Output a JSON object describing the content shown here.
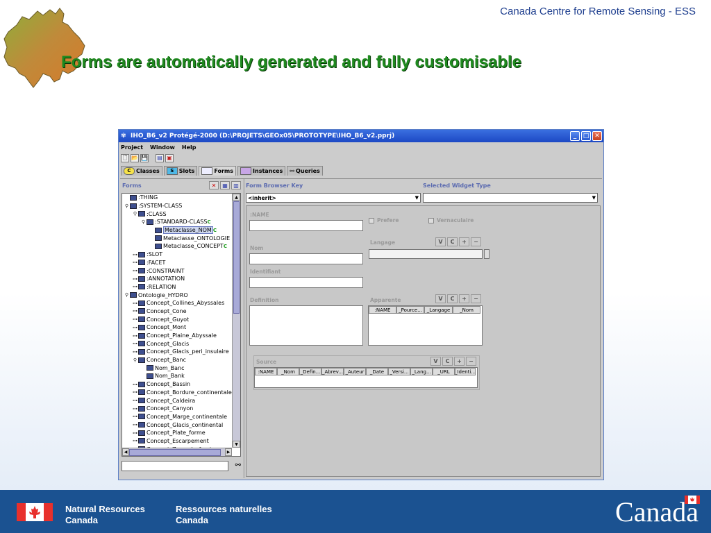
{
  "slide": {
    "header_text": "Canada Centre for Remote Sensing - ESS",
    "title": "Forms are automatically generated and fully customisable"
  },
  "window": {
    "title": "IHO_B6_v2 Protégé-2000    (D:\\PROJETS\\GEOx05\\PROTOTYPE\\IHO_B6_v2.pprj)",
    "controls": [
      "_",
      "□",
      "✕"
    ]
  },
  "menu": [
    "Project",
    "Window",
    "Help"
  ],
  "tabs": [
    {
      "icon": "C",
      "label": "Classes"
    },
    {
      "icon": "S",
      "label": "Slots"
    },
    {
      "icon": "",
      "label": "Forms"
    },
    {
      "icon": "",
      "label": "Instances"
    },
    {
      "icon": "",
      "label": "Queries"
    }
  ],
  "left_panel": {
    "header": "Forms",
    "tree": [
      {
        "indent": 0,
        "toggle": "",
        "label": ":THING"
      },
      {
        "indent": 0,
        "toggle": "⚲",
        "label": ":SYSTEM-CLASS"
      },
      {
        "indent": 1,
        "toggle": "⚲",
        "label": ":CLASS"
      },
      {
        "indent": 2,
        "toggle": "⚲",
        "label": ":STANDARD-CLASS",
        "sup": "C"
      },
      {
        "indent": 3,
        "toggle": "",
        "label": "Metaclasse_NOM",
        "sup": "C",
        "selected": true
      },
      {
        "indent": 3,
        "toggle": "",
        "label": "Metaclasse_ONTOLOGIE"
      },
      {
        "indent": 3,
        "toggle": "",
        "label": "Metaclasse_CONCEPT",
        "sup": "C"
      },
      {
        "indent": 1,
        "toggle": "⊶",
        "label": ":SLOT"
      },
      {
        "indent": 1,
        "toggle": "⊶",
        "label": ":FACET"
      },
      {
        "indent": 1,
        "toggle": "⊶",
        "label": ":CONSTRAINT"
      },
      {
        "indent": 1,
        "toggle": "⊶",
        "label": ":ANNOTATION"
      },
      {
        "indent": 1,
        "toggle": "⊶",
        "label": ":RELATION"
      },
      {
        "indent": 0,
        "toggle": "⚲",
        "label": "Ontologie_HYDRO"
      },
      {
        "indent": 1,
        "toggle": "⊶",
        "label": "Concept_Collines_Abyssales"
      },
      {
        "indent": 1,
        "toggle": "⊶",
        "label": "Concept_Cone"
      },
      {
        "indent": 1,
        "toggle": "⊶",
        "label": "Concept_Guyot"
      },
      {
        "indent": 1,
        "toggle": "⊶",
        "label": "Concept_Mont"
      },
      {
        "indent": 1,
        "toggle": "⊶",
        "label": "Concept_Plaine_Abyssale"
      },
      {
        "indent": 1,
        "toggle": "⊶",
        "label": "Concept_Glacis"
      },
      {
        "indent": 1,
        "toggle": "⊶",
        "label": "Concept_Glacis_peri_insulaire"
      },
      {
        "indent": 1,
        "toggle": "⚲",
        "label": "Concept_Banc"
      },
      {
        "indent": 2,
        "toggle": "",
        "label": "Nom_Banc"
      },
      {
        "indent": 2,
        "toggle": "",
        "label": "Nom_Bank"
      },
      {
        "indent": 1,
        "toggle": "⊶",
        "label": "Concept_Bassin"
      },
      {
        "indent": 1,
        "toggle": "⊶",
        "label": "Concept_Bordure_continentale"
      },
      {
        "indent": 1,
        "toggle": "⊶",
        "label": "Concept_Caldeira"
      },
      {
        "indent": 1,
        "toggle": "⊶",
        "label": "Concept_Canyon"
      },
      {
        "indent": 1,
        "toggle": "⊶",
        "label": "Concept_Marge_continentale"
      },
      {
        "indent": 1,
        "toggle": "⊶",
        "label": "Concept_Glacis_continental"
      },
      {
        "indent": 1,
        "toggle": "⊶",
        "label": "Concept_Plate_forme"
      },
      {
        "indent": 1,
        "toggle": "⊶",
        "label": "Concept_Escarpement"
      },
      {
        "indent": 1,
        "toggle": "⊶",
        "label": "Concept_Zone_de_fractures"
      }
    ],
    "find_value": ""
  },
  "right_panel": {
    "browser_key_label": "Form Browser Key",
    "widget_type_label": "Selected Widget Type",
    "browser_key_value": "<inherit>",
    "widget_type_value": "",
    "form": {
      "name_label": ":NAME",
      "nom_label": "Nom",
      "identifiant_label": "Identifiant",
      "definition_label": "Definition",
      "prefere_label": "Prefere",
      "vernaculaire_label": "Vernaculaire",
      "langage_label": "Langage",
      "apparente_label": "Apparente",
      "source_label": "Source",
      "widget_buttons": [
        "V",
        "C",
        "+",
        "−"
      ],
      "apparente_columns": [
        ":NAME",
        "_Pource...",
        "_Langage",
        "_Nom"
      ],
      "source_columns": [
        ":NAME",
        "_Nom",
        "_Defin...",
        "_Abrev...",
        "_Auteur",
        "_Date",
        "_Versi...",
        "_Lang...",
        "_URL",
        "_Identi..."
      ]
    }
  },
  "footer": {
    "dept_en_line1": "Natural Resources",
    "dept_en_line2": "Canada",
    "dept_fr_line1": "Ressources naturelles",
    "dept_fr_line2": "Canada",
    "wordmark": "Canada"
  },
  "colors": {
    "title_green": "#1f8a1f",
    "header_blue": "#1f3f8f",
    "footer_blue": "#1b5291",
    "flag_red": "#e8302c"
  }
}
